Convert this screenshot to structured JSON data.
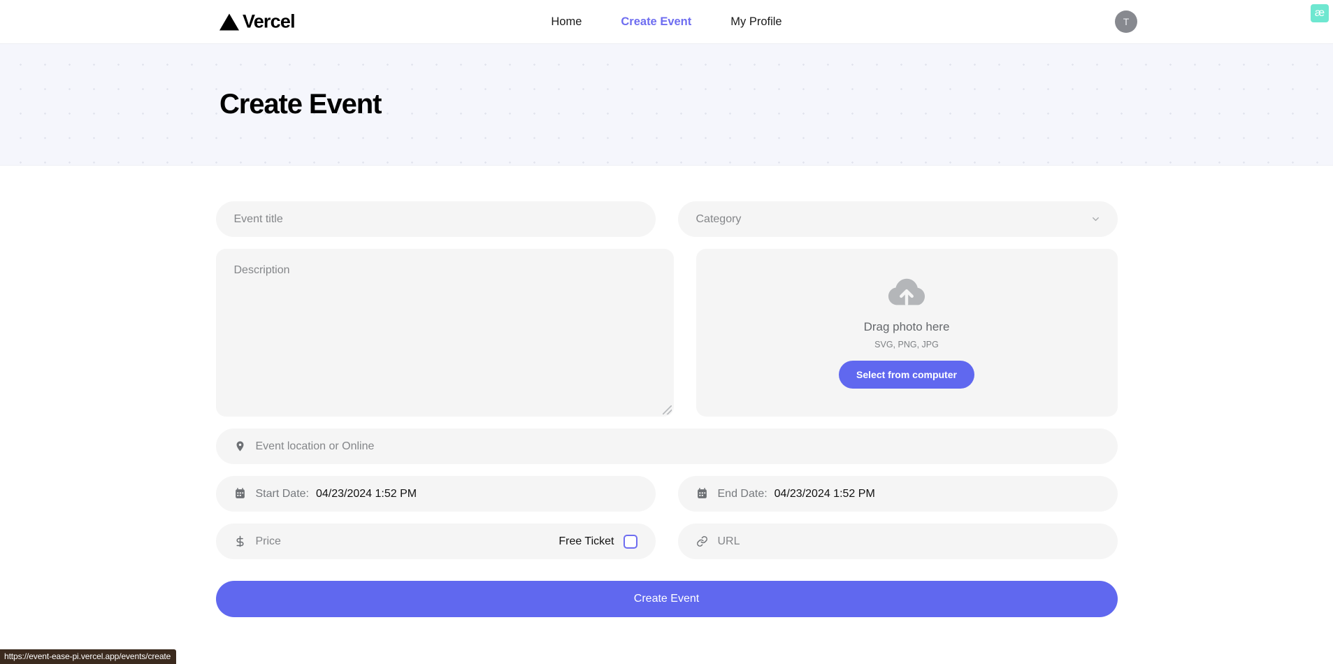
{
  "header": {
    "brand": {
      "name": "Vercel",
      "logo_icon": "vercel-triangle-icon"
    },
    "nav": [
      {
        "label": "Home",
        "active": false
      },
      {
        "label": "Create Event",
        "active": true
      },
      {
        "label": "My Profile",
        "active": false
      }
    ],
    "avatar_initial": "T",
    "extension_badge": "æ"
  },
  "hero": {
    "title": "Create Event"
  },
  "form": {
    "event_title": {
      "placeholder": "Event title",
      "value": ""
    },
    "category": {
      "placeholder": "Category",
      "value": "",
      "chevron_icon": "chevron-down-icon"
    },
    "description": {
      "placeholder": "Description",
      "value": ""
    },
    "upload": {
      "icon": "cloud-upload-icon",
      "title": "Drag photo here",
      "formats": "SVG, PNG, JPG",
      "button_label": "Select from computer"
    },
    "location": {
      "placeholder": "Event location or Online",
      "value": "",
      "icon": "location-pin-icon"
    },
    "start_date": {
      "label": "Start Date:",
      "value": "04/23/2024 1:52 PM",
      "icon": "calendar-icon"
    },
    "end_date": {
      "label": "End Date:",
      "value": "04/23/2024 1:52 PM",
      "icon": "calendar-icon"
    },
    "price": {
      "placeholder": "Price",
      "value": "",
      "icon": "dollar-icon"
    },
    "free_ticket": {
      "label": "Free Ticket",
      "checked": false
    },
    "url": {
      "placeholder": "URL",
      "value": "",
      "icon": "link-icon"
    },
    "submit_label": "Create Event"
  },
  "statusbar": {
    "url": "https://event-ease-pi.vercel.app/events/create"
  },
  "colors": {
    "accent": "#6068ef",
    "accent_link": "#6e6df0",
    "field_bg": "#f5f5f5",
    "hero_bg": "#f5f6fc",
    "badge_teal": "#6ee7d0"
  }
}
